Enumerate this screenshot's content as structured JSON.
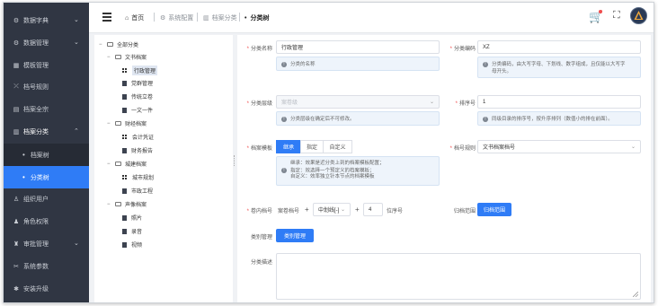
{
  "sidebar": {
    "items": [
      {
        "label": "数据字典",
        "icon": "gear-icon",
        "glyph": "⚙",
        "chev": "⌄"
      },
      {
        "label": "数据管理",
        "icon": "gear-icon",
        "glyph": "⚙",
        "chev": "⌄"
      },
      {
        "label": "模板管理",
        "icon": "template-icon",
        "glyph": "▦"
      },
      {
        "label": "档号规则",
        "icon": "rule-icon",
        "glyph": "⤫"
      },
      {
        "label": "档案全宗",
        "icon": "archive-icon",
        "glyph": "▤"
      },
      {
        "label": "档案分类",
        "icon": "category-icon",
        "glyph": "▥",
        "chev": "⌃"
      },
      {
        "label": "组织用户",
        "icon": "users-icon",
        "glyph": "♙"
      },
      {
        "label": "角色权限",
        "icon": "role-icon",
        "glyph": "♟"
      },
      {
        "label": "审批管理",
        "icon": "approval-icon",
        "glyph": "♜",
        "chev": "⌄"
      },
      {
        "label": "系统参数",
        "icon": "params-icon",
        "glyph": "✂"
      },
      {
        "label": "安装升级",
        "icon": "upgrade-icon",
        "glyph": "✱"
      }
    ],
    "subs": [
      {
        "label": "档案树"
      },
      {
        "label": "分类树"
      }
    ]
  },
  "header": {
    "crumbs": [
      "首页",
      "系统配置",
      "档案分类",
      "分类树"
    ],
    "home_glyph": "⌂",
    "cart_glyph": "🛒",
    "full_glyph": "⛶"
  },
  "tree": {
    "nodes": [
      {
        "label": "全部分类",
        "tog": "−",
        "kind": "folder"
      },
      {
        "label": "文书档案",
        "tog": "−",
        "kind": "folder"
      },
      {
        "label": "行政管理",
        "kind": "grid"
      },
      {
        "label": "党群管理",
        "kind": "file"
      },
      {
        "label": "传统立卷",
        "kind": "file"
      },
      {
        "label": "一文一件",
        "kind": "file"
      },
      {
        "label": "财经档案",
        "tog": "−",
        "kind": "folder"
      },
      {
        "label": "会计凭证",
        "kind": "grid"
      },
      {
        "label": "财务报告",
        "kind": "file"
      },
      {
        "label": "城建档案",
        "tog": "−",
        "kind": "folder"
      },
      {
        "label": "城市规划",
        "kind": "grid"
      },
      {
        "label": "市政工程",
        "kind": "file"
      },
      {
        "label": "声像档案",
        "tog": "−",
        "kind": "folder"
      },
      {
        "label": "照片",
        "kind": "file"
      },
      {
        "label": "录音",
        "kind": "file"
      },
      {
        "label": "视频",
        "kind": "file"
      }
    ]
  },
  "form": {
    "name_label": "分类名称",
    "name_value": "行政管理",
    "name_hint": "分类的名称",
    "code_label": "分类编码",
    "code_value": "XZ",
    "code_hint_1": "分类编码，由大写字母、下划线、数字组成，且仅能以大写字",
    "code_hint_2": "母开头。",
    "level_label": "分类层级",
    "level_placeholder": "案卷级",
    "level_hint": "分类层级在确定后不可修改。",
    "order_label": "排序号",
    "order_value": "1",
    "order_hint": "同级目录的排序号，按升序排列（数值小的排在前面）。",
    "template_label": "档案模板",
    "template_options": [
      "继承",
      "指定",
      "自定义"
    ],
    "template_hint_1": "继承：效果是近分类上到的档案模板配置；",
    "template_hint_2": "指定：效选择一个预定义的档案模板；",
    "template_hint_3": "自定义：效率独立针本节点的档案模板",
    "rule_label": "档号规则",
    "rule_value": "文书档案档号",
    "volume_label": "卷内档号",
    "volume_prefix": "案卷档号",
    "plus": "+",
    "volume_sep": "中划线[-]",
    "volume_digits": "4",
    "volume_suffix": "位序号",
    "archive_range_label": "归档范围",
    "archive_range_btn": "归档范围",
    "category_mgmt_label": "类别管理",
    "category_mgmt_btn": "类别管理",
    "desc_label": "分类描述"
  }
}
